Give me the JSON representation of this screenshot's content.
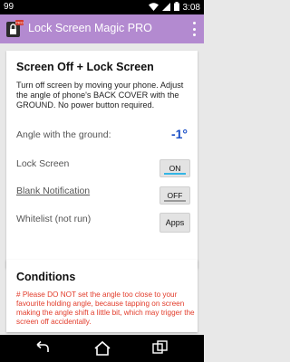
{
  "status_bar": {
    "left_text": "99",
    "time": "3:08",
    "icons": [
      "wifi-icon",
      "signal-icon",
      "battery-icon"
    ]
  },
  "app_bar": {
    "title": "Lock Screen Magic PRO",
    "app_icon": "lock-app-icon",
    "badge_text": "PRO",
    "overflow_icon": "overflow-menu-icon"
  },
  "card_screen_off": {
    "title": "Screen Off + Lock Screen",
    "description": "Turn off screen by moving your phone. Adjust the angle of phone's BACK COVER with the GROUND. No power button required.",
    "angle_label": "Angle with the ground:",
    "angle_value": "-1°",
    "rows": [
      {
        "label": "Lock Screen",
        "control": "ON"
      },
      {
        "label": "Blank Notification",
        "control": "OFF"
      },
      {
        "label": "Whitelist (not run)",
        "control": "Apps"
      }
    ]
  },
  "card_conditions": {
    "title": "Conditions",
    "warning": "# Please DO NOT set the angle too close to your favourite holding angle, because tapping on screen making the angle shift a little bit, which may trigger the screen off accidentally."
  },
  "nav_bar": {
    "icons": [
      "back-icon",
      "home-icon",
      "recent-apps-icon"
    ]
  },
  "colors": {
    "app_bar": "#b38ad0",
    "angle_value": "#1b4fc6",
    "warning": "#e23b2a",
    "toggle_on": "#33b5e5"
  }
}
